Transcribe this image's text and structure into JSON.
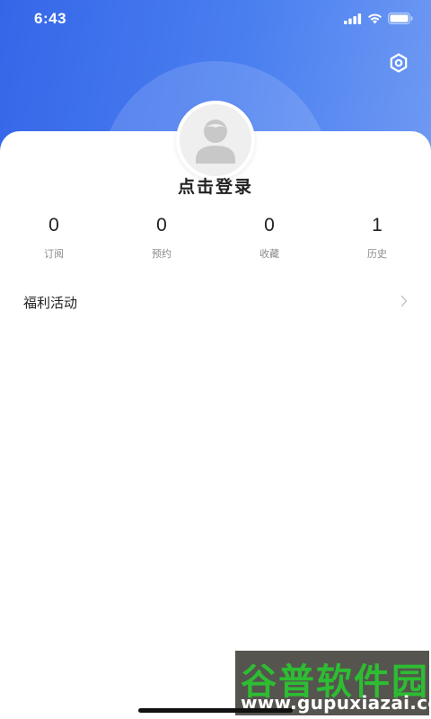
{
  "status_bar": {
    "time": "6:43"
  },
  "profile": {
    "login_prompt": "点击登录"
  },
  "stats": [
    {
      "value": "0",
      "label": "订阅"
    },
    {
      "value": "0",
      "label": "预约"
    },
    {
      "value": "0",
      "label": "收藏"
    },
    {
      "value": "1",
      "label": "历史"
    }
  ],
  "menu": {
    "items": [
      {
        "label": "福利活动"
      }
    ]
  },
  "watermark": {
    "brand": "谷普软件园",
    "url": "www.gupuxiazai.com"
  },
  "colors": {
    "header_start": "#3566e8",
    "header_end": "#6f9af3",
    "watermark_green": "#2dbd32"
  },
  "icons": {
    "settings": "settings-hexagon-icon",
    "avatar": "default-user-avatar-icon",
    "chevron": "chevron-right-icon"
  }
}
